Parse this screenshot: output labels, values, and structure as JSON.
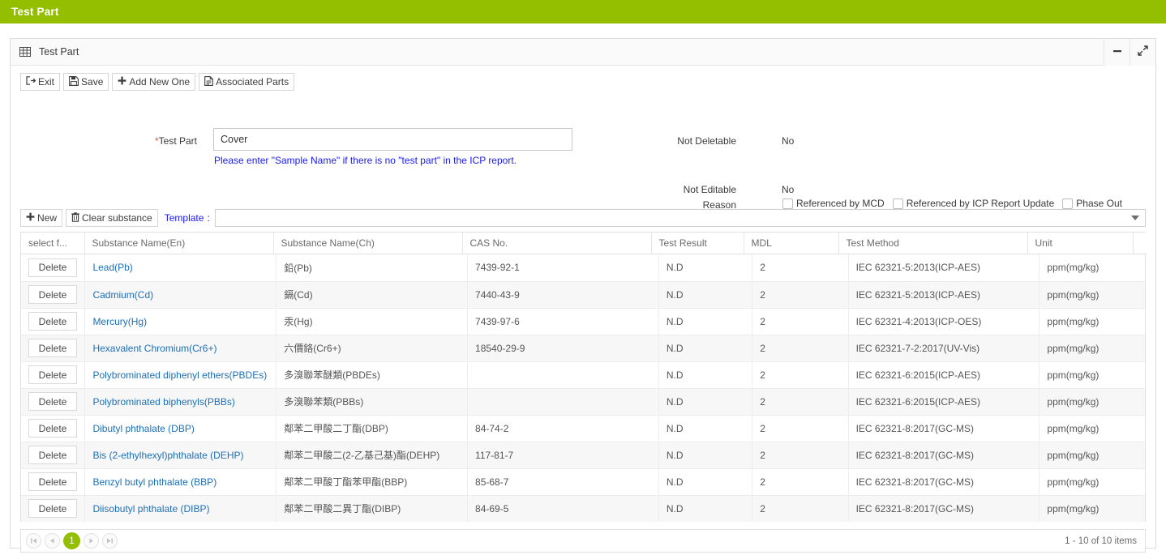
{
  "topbar": {
    "title": "Test Part"
  },
  "panel": {
    "title": "Test Part",
    "icon": "grid-icon",
    "minimize_label": "−",
    "expand_label": "⤢"
  },
  "toolbar": {
    "exit_label": "Exit",
    "save_label": "Save",
    "add_new_one_label": "Add New One",
    "associated_parts_label": "Associated Parts"
  },
  "form": {
    "test_part_label": "Test Part",
    "test_part_required_mark": "*",
    "test_part_value": "Cover",
    "test_part_placeholder": "",
    "hint": "Please enter \"Sample Name\" if there is no \"test part\" in the ICP report.",
    "not_deletable_label": "Not Deletable",
    "not_deletable_value": "No",
    "not_editable_label": "Not Editable",
    "not_editable_value": "No",
    "reason_label": "Reason",
    "reasons": [
      {
        "label": "Referenced by MCD",
        "checked": false
      },
      {
        "label": "Referenced by ICP Report Update",
        "checked": false
      },
      {
        "label": "Phase Out",
        "checked": false
      }
    ]
  },
  "grid_toolbar": {
    "new_label": "New",
    "clear_substance_label": "Clear substance",
    "template_label": "Template",
    "template_colon": ":",
    "template_value": "",
    "template_placeholder": ""
  },
  "grid": {
    "columns": [
      "select f...",
      "Substance Name(En)",
      "Substance Name(Ch)",
      "CAS No.",
      "Test Result",
      "MDL",
      "Test Method",
      "Unit"
    ],
    "row_action_label": "Delete",
    "rows": [
      {
        "name_en": "Lead(Pb)",
        "name_ch": "鉛(Pb)",
        "cas": "7439-92-1",
        "result": "N.D",
        "mdl": "2",
        "method": "IEC 62321-5:2013(ICP-AES)",
        "unit": "ppm(mg/kg)"
      },
      {
        "name_en": "Cadmium(Cd)",
        "name_ch": "鎘(Cd)",
        "cas": "7440-43-9",
        "result": "N.D",
        "mdl": "2",
        "method": "IEC 62321-5:2013(ICP-AES)",
        "unit": "ppm(mg/kg)"
      },
      {
        "name_en": "Mercury(Hg)",
        "name_ch": "汞(Hg)",
        "cas": "7439-97-6",
        "result": "N.D",
        "mdl": "2",
        "method": "IEC 62321-4:2013(ICP-OES)",
        "unit": "ppm(mg/kg)"
      },
      {
        "name_en": "Hexavalent Chromium(Cr6+)",
        "name_ch": "六價鉻(Cr6+)",
        "cas": "18540-29-9",
        "result": "N.D",
        "mdl": "2",
        "method": "IEC 62321-7-2:2017(UV-Vis)",
        "unit": "ppm(mg/kg)"
      },
      {
        "name_en": "Polybrominated diphenyl ethers(PBDEs)",
        "name_ch": "多溴聯苯醚類(PBDEs)",
        "cas": "",
        "result": "N.D",
        "mdl": "2",
        "method": "IEC 62321-6:2015(ICP-AES)",
        "unit": "ppm(mg/kg)"
      },
      {
        "name_en": "Polybrominated biphenyls(PBBs)",
        "name_ch": "多溴聯苯類(PBBs)",
        "cas": "",
        "result": "N.D",
        "mdl": "2",
        "method": "IEC 62321-6:2015(ICP-AES)",
        "unit": "ppm(mg/kg)"
      },
      {
        "name_en": "Dibutyl phthalate (DBP)",
        "name_ch": "鄰苯二甲酸二丁酯(DBP)",
        "cas": "84-74-2",
        "result": "N.D",
        "mdl": "2",
        "method": "IEC 62321-8:2017(GC-MS)",
        "unit": "ppm(mg/kg)"
      },
      {
        "name_en": "Bis (2-ethylhexyl)phthalate (DEHP)",
        "name_ch": "鄰苯二甲酸二(2-乙基己基)酯(DEHP)",
        "cas": "117-81-7",
        "result": "N.D",
        "mdl": "2",
        "method": "IEC 62321-8:2017(GC-MS)",
        "unit": "ppm(mg/kg)"
      },
      {
        "name_en": "Benzyl butyl phthalate (BBP)",
        "name_ch": "鄰苯二甲酸丁酯苯甲酯(BBP)",
        "cas": "85-68-7",
        "result": "N.D",
        "mdl": "2",
        "method": "IEC 62321-8:2017(GC-MS)",
        "unit": "ppm(mg/kg)"
      },
      {
        "name_en": "Diisobutyl phthalate (DIBP)",
        "name_ch": "鄰苯二甲酸二異丁酯(DIBP)",
        "cas": "84-69-5",
        "result": "N.D",
        "mdl": "2",
        "method": "IEC 62321-8:2017(GC-MS)",
        "unit": "ppm(mg/kg)"
      }
    ]
  },
  "pager": {
    "first_label": "⏮",
    "prev_label": "◀",
    "current_page": "1",
    "next_label": "▶",
    "last_label": "⏭",
    "info": "1 - 10 of 10 items"
  },
  "colors": {
    "brand_green": "#93bf00",
    "link_blue": "#1d6fb8",
    "hint_blue": "#1a1aee",
    "required_red": "#d9534f"
  }
}
